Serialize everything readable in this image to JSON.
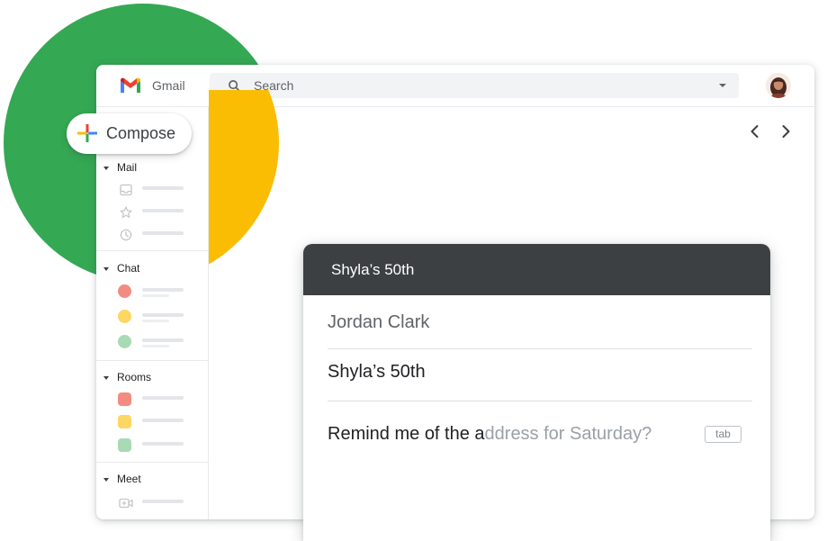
{
  "colors": {
    "green": "#34A853",
    "yellow": "#FBBC04",
    "red": "#EA4335",
    "blue": "#4285F4",
    "card_header": "#3c4043"
  },
  "header": {
    "app_name": "Gmail",
    "search_placeholder": "Search",
    "search_icon": "search-icon",
    "avatar": "avatar"
  },
  "compose": {
    "label": "Compose",
    "icon": "plus-icon"
  },
  "sidebar": {
    "sections": [
      {
        "title": "Mail",
        "items": [
          "inbox-icon",
          "star-icon",
          "clock-icon"
        ]
      },
      {
        "title": "Chat",
        "items": [
          "#F28B82",
          "#FDD663",
          "#A8DAB5"
        ]
      },
      {
        "title": "Rooms",
        "items": [
          "#F28B82",
          "#FDD663",
          "#A8DAB5"
        ]
      },
      {
        "title": "Meet",
        "items": [
          "video-icon"
        ]
      }
    ]
  },
  "nav": {
    "prev_icon": "chevron-left-icon",
    "next_icon": "chevron-right-icon"
  },
  "compose_window": {
    "title": "Shyla’s 50th",
    "to": "Jordan Clark",
    "subject": "Shyla’s 50th",
    "body_typed": "Remind me of the a",
    "body_suggestion": "ddress for Saturday?",
    "tab_hint": "tab"
  }
}
